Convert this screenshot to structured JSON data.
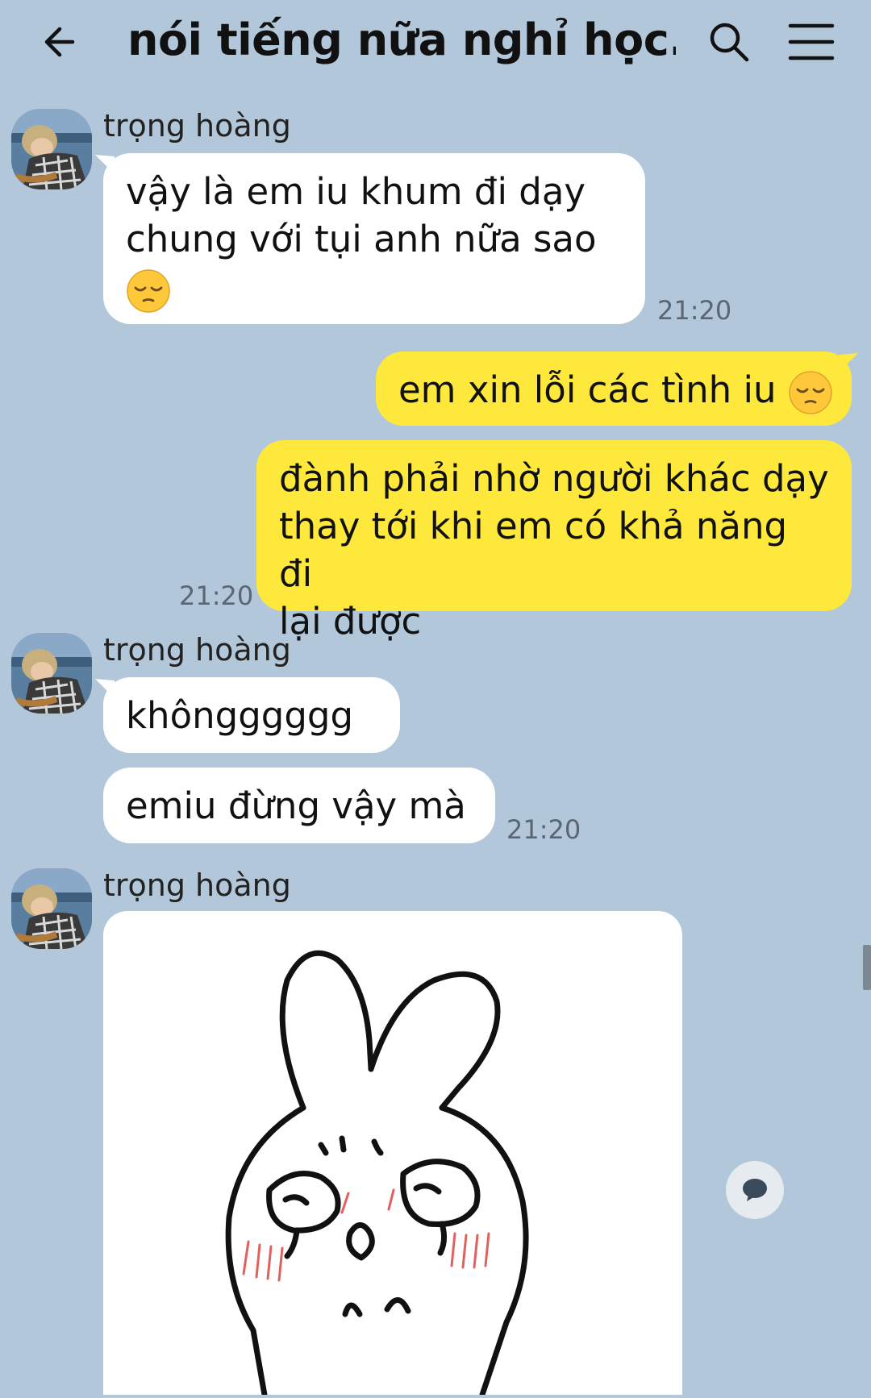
{
  "header": {
    "title": "nói tiếng nữa nghỉ học...",
    "back_icon": "arrow-left-icon",
    "search_icon": "search-icon",
    "menu_icon": "menu-icon"
  },
  "messages": [
    {
      "sender": "trọng hoàng",
      "lines": [
        "vậy là em iu khum đi dạy",
        "chung với tụi anh nữa sao"
      ],
      "emoji": "😔",
      "time": "21:20"
    },
    {
      "text": "em xin lỗi các tình iu",
      "emoji": "😔"
    },
    {
      "lines": [
        "đành phải nhờ người khác dạy",
        "thay tới khi em có khả năng đi",
        "lại được"
      ],
      "time": "21:20"
    },
    {
      "sender": "trọng hoàng",
      "text": "khôngggggg"
    },
    {
      "text": "emiu đừng vậy mà",
      "time": "21:20"
    },
    {
      "sender": "trọng hoàng",
      "sticker": "crying-bunny-sticker"
    }
  ],
  "colors": {
    "background": "#b2c7d9",
    "incoming_bubble": "#ffffff",
    "outgoing_bubble": "#fee83b"
  }
}
